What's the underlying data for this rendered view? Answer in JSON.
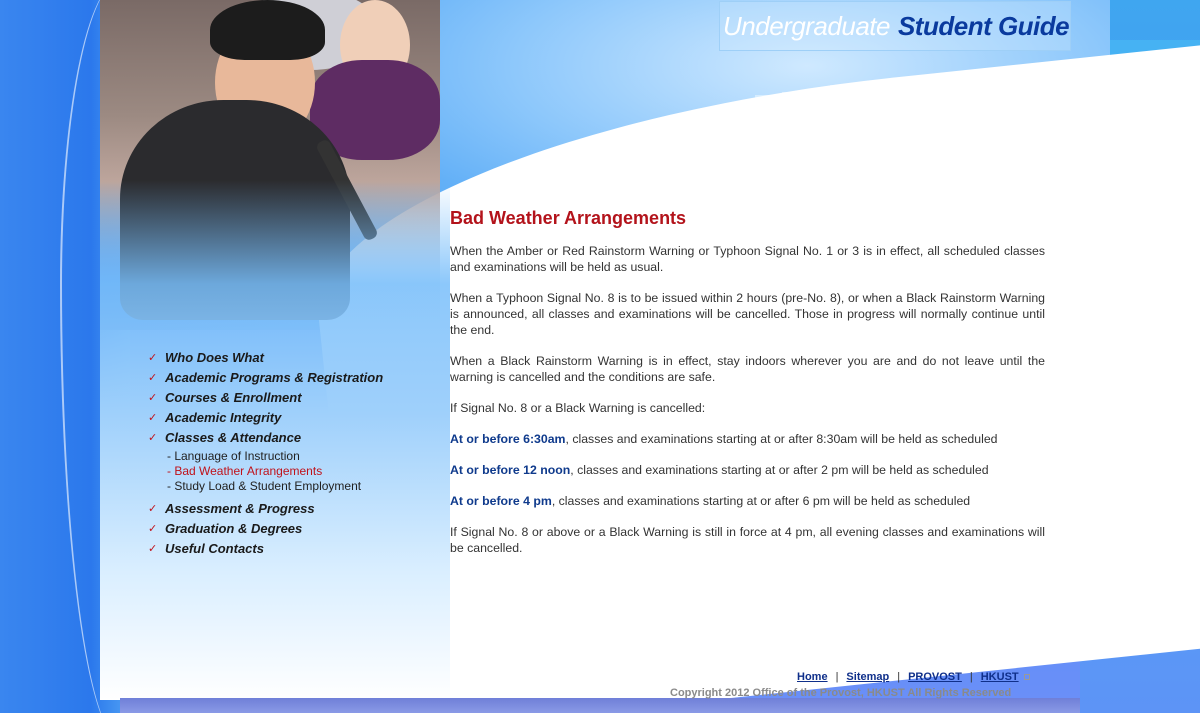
{
  "header": {
    "logo_light": "Undergraduate",
    "logo_bold": "Student Guide"
  },
  "menu": {
    "items_top": [
      {
        "label": "Who Does What"
      },
      {
        "label": "Academic Programs & Registration"
      },
      {
        "label": "Courses & Enrollment"
      },
      {
        "label": "Academic Integrity"
      },
      {
        "label": "Classes & Attendance"
      }
    ],
    "submenu": [
      {
        "label": "- Language of Instruction"
      },
      {
        "label": "- Bad Weather Arrangements"
      },
      {
        "label": "- Study Load & Student Employment"
      }
    ],
    "items_bottom": [
      {
        "label": "Assessment & Progress"
      },
      {
        "label": "Graduation & Degrees"
      },
      {
        "label": "Useful Contacts"
      }
    ]
  },
  "content": {
    "title": "Bad Weather Arrangements",
    "p1": "When the Amber or Red Rainstorm Warning or Typhoon Signal No. 1 or 3 is in effect, all scheduled classes and examinations will be held as usual.",
    "p2": "When a Typhoon Signal No. 8 is to be issued within 2 hours (pre-No. 8), or when a Black Rainstorm Warning is announced, all classes and examinations will be cancelled. Those in progress will normally continue until the end.",
    "p3": "When a Black Rainstorm Warning is in effect, stay indoors wherever you are and do not leave until the warning is cancelled and the conditions are safe.",
    "p4": "If Signal No. 8 or a Black Warning is cancelled:",
    "rules": [
      {
        "time": "At or before 6:30am",
        "text": ", classes and examinations starting at or after 8:30am will be held as scheduled"
      },
      {
        "time": "At or before 12 noon",
        "text": ", classes and examinations starting at or after 2 pm will be held as scheduled"
      },
      {
        "time": "At or before 4 pm",
        "text": ", classes and examinations starting at or after 6 pm will be held as scheduled"
      }
    ],
    "p5": "If Signal No. 8 or above or a Black Warning is still in force at 4 pm, all evening classes and examinations will be cancelled."
  },
  "footer": {
    "links": [
      "Home",
      "Sitemap",
      "PROVOST",
      "HKUST"
    ],
    "separator": "|",
    "copyright": "Copyright 2012 Office of the Provost, HKUST   All Rights Reserved"
  },
  "colors": {
    "accent_red": "#b3131b",
    "link_blue": "#0f2f8a",
    "background_blue": "#3f8ff2"
  }
}
